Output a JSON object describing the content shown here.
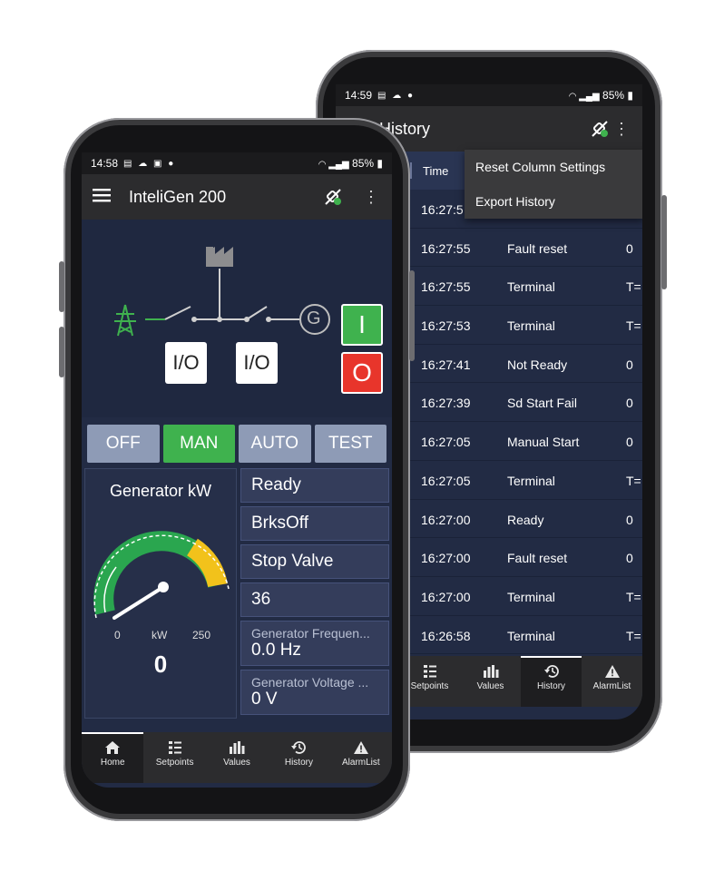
{
  "back_phone": {
    "status": {
      "time": "14:59",
      "battery": "85%"
    },
    "appbar": {
      "title": "History"
    },
    "table": {
      "time_header": "Time",
      "rows": [
        {
          "time": "16:27:5",
          "name": "",
          "value": ""
        },
        {
          "time": "16:27:55",
          "name": "Fault reset",
          "value": "0"
        },
        {
          "time": "16:27:55",
          "name": "Terminal",
          "value": "T="
        },
        {
          "time": "16:27:53",
          "name": "Terminal",
          "value": "T="
        },
        {
          "time": "16:27:41",
          "name": "Not Ready",
          "value": "0"
        },
        {
          "time": "16:27:39",
          "name": "Sd Start Fail",
          "value": "0"
        },
        {
          "time": "16:27:05",
          "name": "Manual Start",
          "value": "0"
        },
        {
          "time": "16:27:05",
          "name": "Terminal",
          "value": "T="
        },
        {
          "time": "16:27:00",
          "name": "Ready",
          "value": "0"
        },
        {
          "time": "16:27:00",
          "name": "Fault reset",
          "value": "0"
        },
        {
          "time": "16:27:00",
          "name": "Terminal",
          "value": "T="
        },
        {
          "time": "16:26:58",
          "name": "Terminal",
          "value": "T="
        }
      ]
    },
    "menu": {
      "reset_columns": "Reset Column Settings",
      "export_history": "Export History"
    },
    "nav": [
      {
        "label": "Setpoints",
        "icon": "setpoints-icon"
      },
      {
        "label": "Values",
        "icon": "values-icon"
      },
      {
        "label": "History",
        "icon": "history-icon",
        "active": true
      },
      {
        "label": "AlarmList",
        "icon": "alarm-icon"
      }
    ]
  },
  "front_phone": {
    "status": {
      "time": "14:58",
      "battery": "85%"
    },
    "appbar": {
      "title": "InteliGen 200"
    },
    "diagram": {
      "breaker_left": "I/O",
      "breaker_right": "I/O",
      "generator_symbol": "G",
      "start_label": "I",
      "stop_label": "O"
    },
    "modes": [
      {
        "label": "OFF"
      },
      {
        "label": "MAN",
        "active": true
      },
      {
        "label": "AUTO"
      },
      {
        "label": "TEST"
      }
    ],
    "gauge": {
      "title": "Generator kW",
      "min": "0",
      "unit": "kW",
      "max": "250",
      "value": "0",
      "value_num": 0,
      "max_num": 250
    },
    "values": {
      "state": "Ready",
      "breaker_state": "BrksOff",
      "valve": "Stop Valve",
      "number": "36",
      "freq_label": "Generator Frequen...",
      "freq_value": "0.0  Hz",
      "volt_label": "Generator Voltage ...",
      "volt_value": "0  V"
    },
    "nav": [
      {
        "label": "Home",
        "icon": "home-icon",
        "active": true
      },
      {
        "label": "Setpoints",
        "icon": "setpoints-icon"
      },
      {
        "label": "Values",
        "icon": "values-icon"
      },
      {
        "label": "History",
        "icon": "history-icon"
      },
      {
        "label": "AlarmList",
        "icon": "alarm-icon"
      }
    ]
  },
  "colors": {
    "accent_green": "#3fb24e",
    "stop_red": "#e8352b",
    "gauge_yellow": "#f2c21b",
    "panel_bg": "#222b44"
  }
}
